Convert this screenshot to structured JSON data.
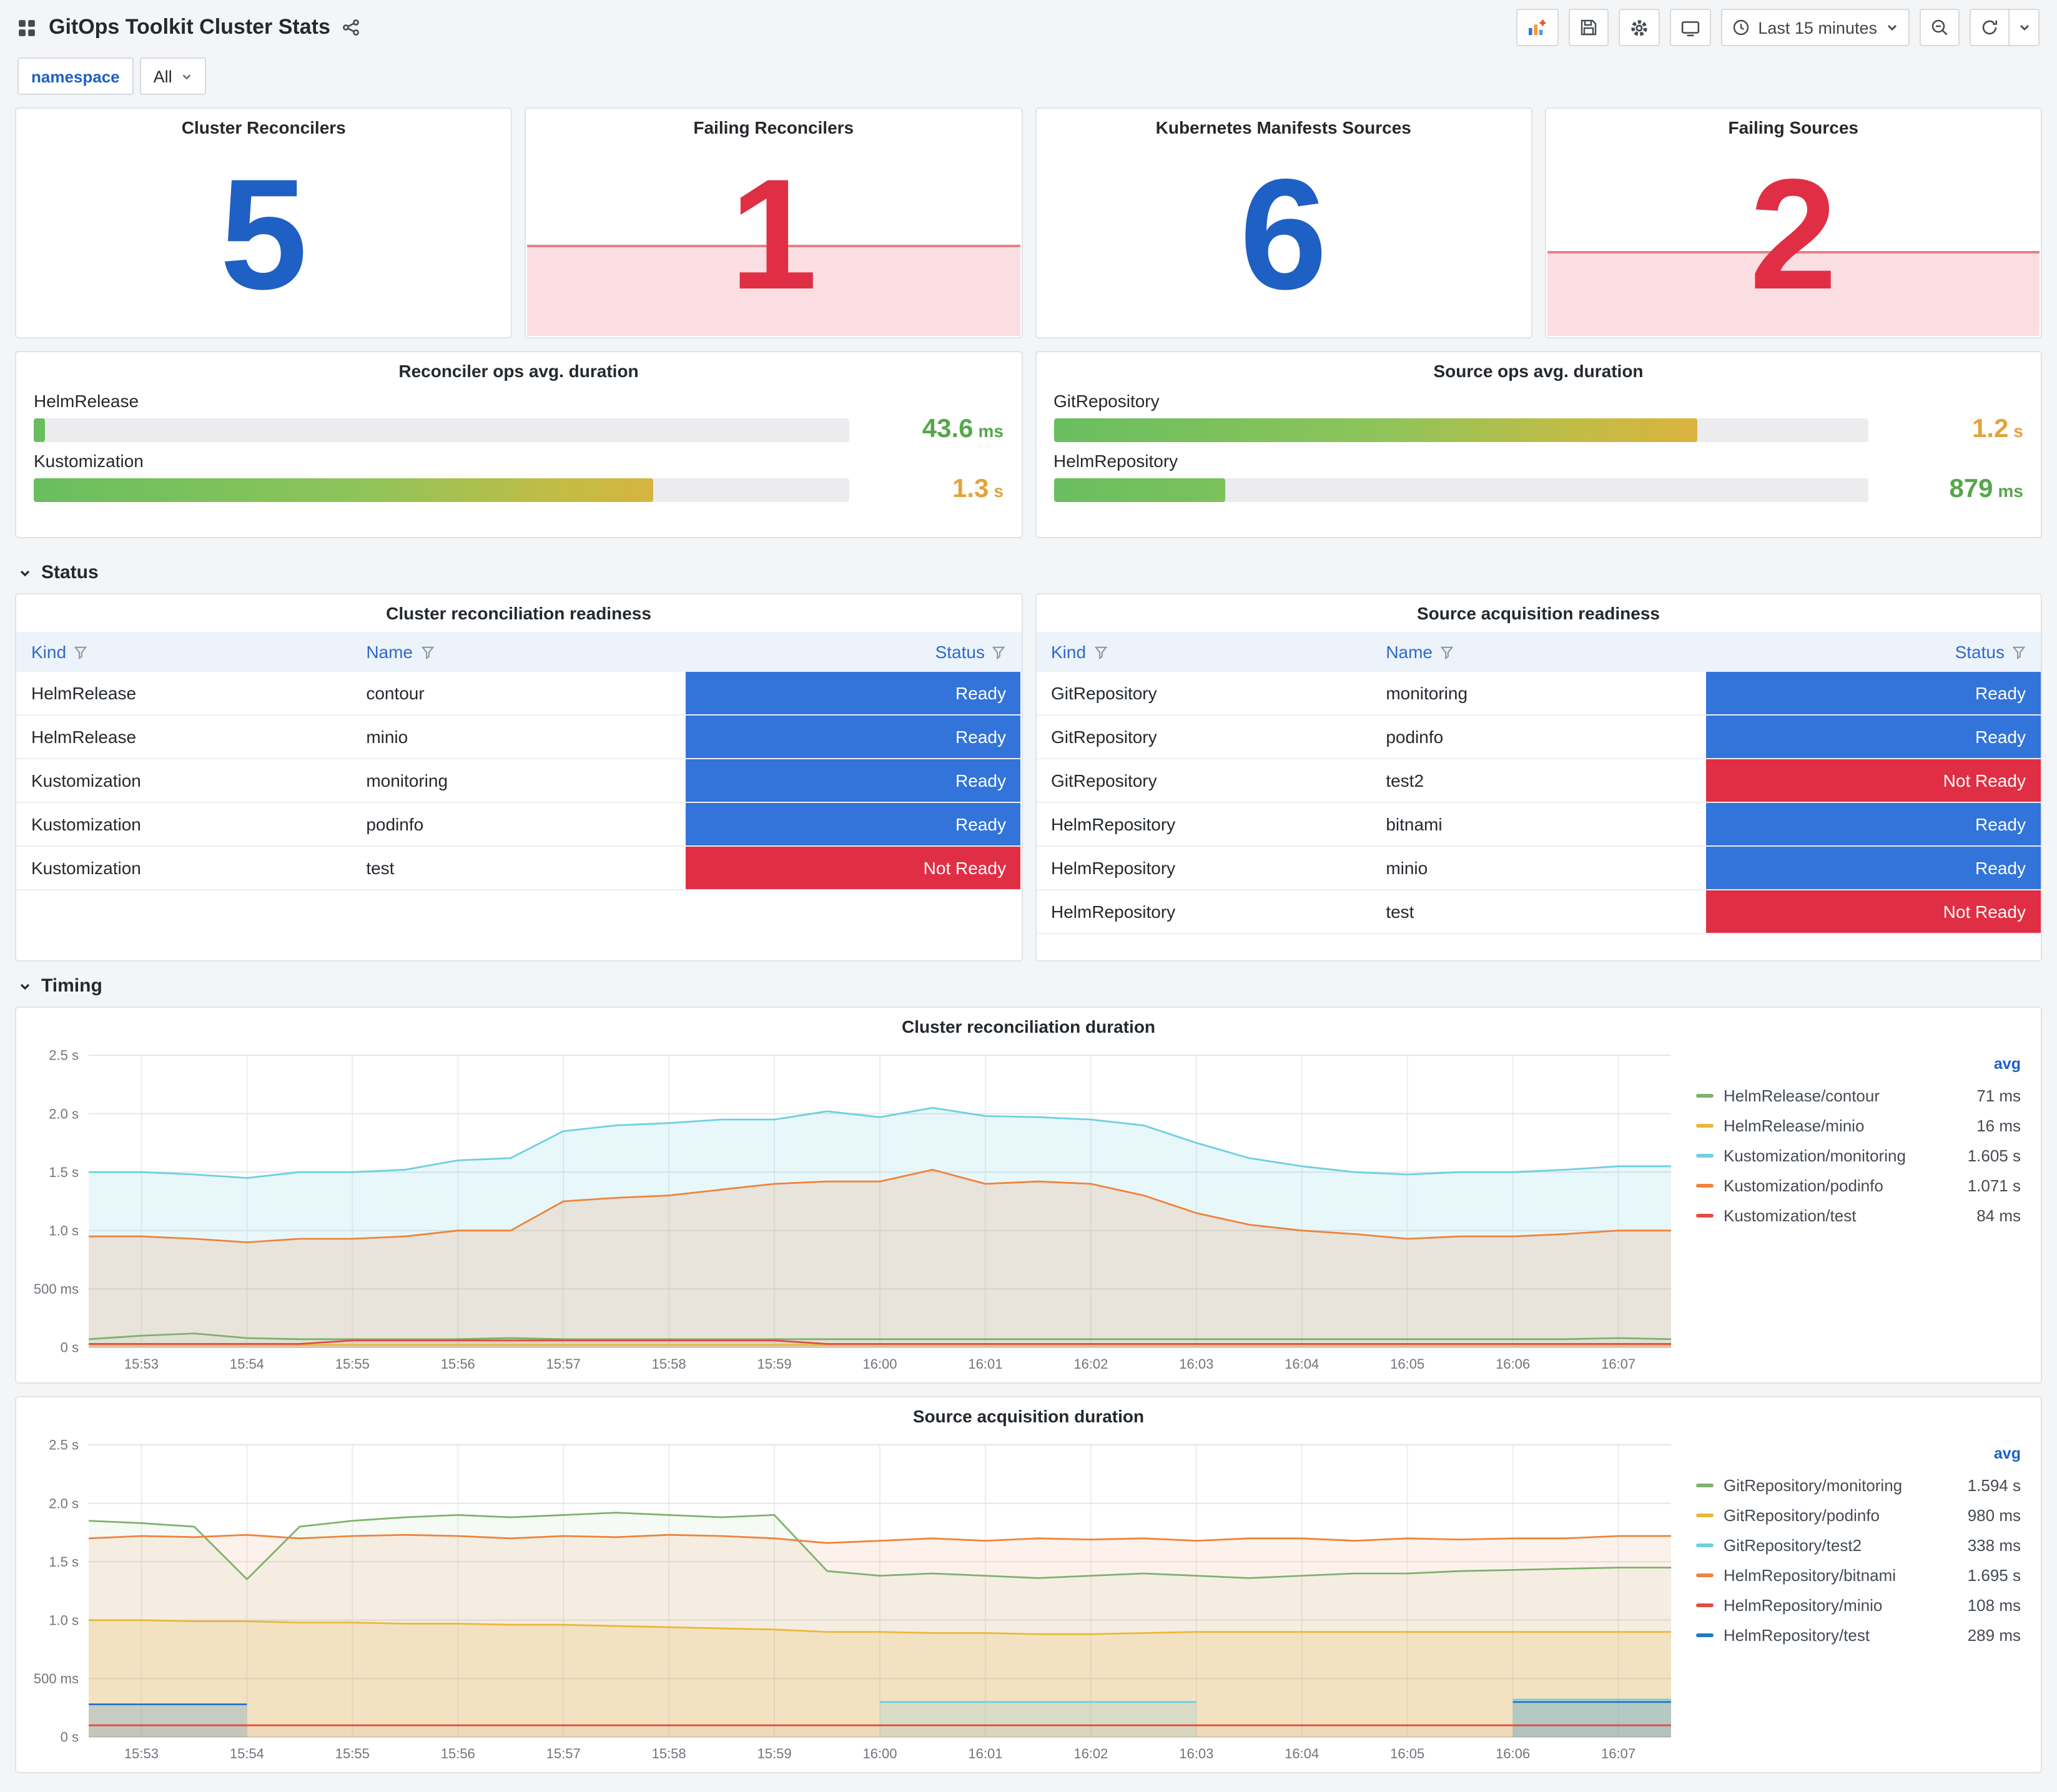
{
  "header": {
    "title": "GitOps Toolkit Cluster Stats",
    "time_range": "Last 15 minutes"
  },
  "filters": {
    "namespace_label": "namespace",
    "namespace_value": "All"
  },
  "sections": {
    "status": "Status",
    "timing": "Timing"
  },
  "icons": {
    "dashboard-grid": "grid-2x2",
    "share": "share-nodes",
    "add-panel": "chart-plus",
    "save": "floppy-disk",
    "settings": "gear",
    "tv": "monitor",
    "clock": "clock",
    "zoom-out": "magnifier-minus",
    "refresh": "sync-arrows",
    "caret": "chevron-down",
    "filter": "funnel",
    "section-chevron": "chevron-down"
  },
  "stats": [
    {
      "title": "Cluster Reconcilers",
      "value": "5",
      "color": "#1F60C4",
      "sparkline": false,
      "spark_height": 0
    },
    {
      "title": "Failing Reconcilers",
      "value": "1",
      "color": "#E02F44",
      "sparkline": true,
      "spark_height": 0.4,
      "spark_fill": "rgba(224,47,68,0.16)",
      "spark_line": "rgba(224,47,68,0.55)"
    },
    {
      "title": "Kubernetes Manifests Sources",
      "value": "6",
      "color": "#1F60C4",
      "sparkline": false,
      "spark_height": 0
    },
    {
      "title": "Failing Sources",
      "value": "2",
      "color": "#E02F44",
      "sparkline": true,
      "spark_height": 0.37,
      "spark_fill": "rgba(224,47,68,0.16)",
      "spark_line": "rgba(224,47,68,0.55)"
    }
  ],
  "gauge_gradient": [
    "#69BE5F",
    "#8EC45A",
    "#C3BC45",
    "#E5AE3B",
    "#EA9A33"
  ],
  "gauges": [
    {
      "title": "Reconciler ops avg. duration",
      "rows": [
        {
          "label": "HelmRelease",
          "percent": 1.4,
          "value": "43.6",
          "unit": "ms",
          "value_color": "#56A64B"
        },
        {
          "label": "Kustomization",
          "percent": 76,
          "value": "1.3",
          "unit": "s",
          "value_color": "#E2A33C"
        }
      ]
    },
    {
      "title": "Source ops avg. duration",
      "rows": [
        {
          "label": "GitRepository",
          "percent": 79,
          "value": "1.2",
          "unit": "s",
          "value_color": "#E2A33C"
        },
        {
          "label": "HelmRepository",
          "percent": 21,
          "value": "879",
          "unit": "ms",
          "value_color": "#56A64B"
        }
      ]
    }
  ],
  "status_colors": {
    "Ready": "#3274D9",
    "Not Ready": "#E02F44"
  },
  "tables": [
    {
      "title": "Cluster reconciliation readiness",
      "columns": [
        "Kind",
        "Name",
        "Status"
      ],
      "rows": [
        [
          "HelmRelease",
          "contour",
          "Ready"
        ],
        [
          "HelmRelease",
          "minio",
          "Ready"
        ],
        [
          "Kustomization",
          "monitoring",
          "Ready"
        ],
        [
          "Kustomization",
          "podinfo",
          "Ready"
        ],
        [
          "Kustomization",
          "test",
          "Not Ready"
        ]
      ]
    },
    {
      "title": "Source acquisition readiness",
      "columns": [
        "Kind",
        "Name",
        "Status"
      ],
      "rows": [
        [
          "GitRepository",
          "monitoring",
          "Ready"
        ],
        [
          "GitRepository",
          "podinfo",
          "Ready"
        ],
        [
          "GitRepository",
          "test2",
          "Not Ready"
        ],
        [
          "HelmRepository",
          "bitnami",
          "Ready"
        ],
        [
          "HelmRepository",
          "minio",
          "Ready"
        ],
        [
          "HelmRepository",
          "test",
          "Not Ready"
        ]
      ]
    }
  ],
  "chart_data": [
    {
      "type": "line",
      "title": "Cluster reconciliation duration",
      "xlabel": "",
      "ylabel": "",
      "ylim": [
        0,
        2.5
      ],
      "y_ticks": [
        {
          "v": 0,
          "label": "0 s"
        },
        {
          "v": 0.5,
          "label": "500 ms"
        },
        {
          "v": 1.0,
          "label": "1.0 s"
        },
        {
          "v": 1.5,
          "label": "1.5 s"
        },
        {
          "v": 2.0,
          "label": "2.0 s"
        },
        {
          "v": 2.5,
          "label": "2.5 s"
        }
      ],
      "x_ticks": [
        "15:53",
        "15:54",
        "15:55",
        "15:56",
        "15:57",
        "15:58",
        "15:59",
        "16:00",
        "16:01",
        "16:02",
        "16:03",
        "16:04",
        "16:05",
        "16:06",
        "16:07"
      ],
      "legend_header": "avg",
      "legend_position": "right",
      "grid": true,
      "series": [
        {
          "name": "HelmRelease/contour",
          "color": "#7EB26D",
          "fill": 0.06,
          "avg": "71 ms",
          "values": [
            0.07,
            0.1,
            0.12,
            0.08,
            0.07,
            0.07,
            0.07,
            0.07,
            0.08,
            0.07,
            0.07,
            0.07,
            0.07,
            0.07,
            0.07,
            0.07,
            0.07,
            0.07,
            0.07,
            0.07,
            0.07,
            0.07,
            0.07,
            0.07,
            0.07,
            0.07,
            0.07,
            0.07,
            0.07,
            0.08,
            0.07
          ]
        },
        {
          "name": "HelmRelease/minio",
          "color": "#EAB839",
          "fill": 0.05,
          "avg": "16 ms",
          "values": [
            0.02,
            0.02,
            0.02,
            0.02,
            0.02,
            0.02,
            0.02,
            0.02,
            0.02,
            0.02,
            0.02,
            0.02,
            0.02,
            0.02,
            0.02,
            0.02,
            0.02,
            0.02,
            0.02,
            0.02,
            0.02,
            0.02,
            0.02,
            0.02,
            0.02,
            0.02,
            0.02,
            0.02,
            0.02,
            0.02,
            0.02
          ]
        },
        {
          "name": "Kustomization/monitoring",
          "color": "#6ED0E0",
          "fill": 0.16,
          "avg": "1.605 s",
          "values": [
            1.5,
            1.5,
            1.48,
            1.45,
            1.5,
            1.5,
            1.52,
            1.6,
            1.62,
            1.85,
            1.9,
            1.92,
            1.95,
            1.95,
            2.02,
            1.97,
            2.05,
            1.98,
            1.97,
            1.95,
            1.9,
            1.75,
            1.62,
            1.55,
            1.5,
            1.48,
            1.5,
            1.5,
            1.52,
            1.55,
            1.55
          ]
        },
        {
          "name": "Kustomization/podinfo",
          "color": "#EF843C",
          "fill": 0.16,
          "avg": "1.071 s",
          "values": [
            0.95,
            0.95,
            0.93,
            0.9,
            0.93,
            0.93,
            0.95,
            1.0,
            1.0,
            1.25,
            1.28,
            1.3,
            1.35,
            1.4,
            1.42,
            1.42,
            1.52,
            1.4,
            1.42,
            1.4,
            1.3,
            1.15,
            1.05,
            1.0,
            0.97,
            0.93,
            0.95,
            0.95,
            0.97,
            1.0,
            1.0
          ]
        },
        {
          "name": "Kustomization/test",
          "color": "#E24D42",
          "fill": 0.1,
          "avg": "84 ms",
          "values": [
            0.03,
            0.03,
            0.03,
            0.03,
            0.03,
            0.06,
            0.06,
            0.06,
            0.06,
            0.06,
            0.06,
            0.06,
            0.06,
            0.06,
            0.03,
            0.03,
            0.03,
            0.03,
            0.03,
            0.03,
            0.03,
            0.03,
            0.03,
            0.03,
            0.03,
            0.03,
            0.03,
            0.03,
            0.03,
            0.03,
            0.03
          ]
        }
      ]
    },
    {
      "type": "line",
      "title": "Source acquisition duration",
      "xlabel": "",
      "ylabel": "",
      "ylim": [
        0,
        2.5
      ],
      "y_ticks": [
        {
          "v": 0,
          "label": "0 s"
        },
        {
          "v": 0.5,
          "label": "500 ms"
        },
        {
          "v": 1.0,
          "label": "1.0 s"
        },
        {
          "v": 1.5,
          "label": "1.5 s"
        },
        {
          "v": 2.0,
          "label": "2.0 s"
        },
        {
          "v": 2.5,
          "label": "2.5 s"
        }
      ],
      "x_ticks": [
        "15:53",
        "15:54",
        "15:55",
        "15:56",
        "15:57",
        "15:58",
        "15:59",
        "16:00",
        "16:01",
        "16:02",
        "16:03",
        "16:04",
        "16:05",
        "16:06",
        "16:07"
      ],
      "legend_header": "avg",
      "legend_position": "right",
      "grid": true,
      "series": [
        {
          "name": "GitRepository/monitoring",
          "color": "#7EB26D",
          "fill": 0.07,
          "avg": "1.594 s",
          "values": [
            1.85,
            1.83,
            1.8,
            1.35,
            1.8,
            1.85,
            1.88,
            1.9,
            1.88,
            1.9,
            1.92,
            1.9,
            1.88,
            1.9,
            1.42,
            1.38,
            1.4,
            1.38,
            1.36,
            1.38,
            1.4,
            1.38,
            1.36,
            1.38,
            1.4,
            1.4,
            1.42,
            1.43,
            1.44,
            1.45,
            1.45
          ]
        },
        {
          "name": "GitRepository/podinfo",
          "color": "#EAB839",
          "fill": 0.18,
          "avg": "980 ms",
          "values": [
            1.0,
            1.0,
            0.99,
            0.99,
            0.98,
            0.98,
            0.97,
            0.97,
            0.96,
            0.96,
            0.95,
            0.94,
            0.93,
            0.92,
            0.9,
            0.9,
            0.89,
            0.89,
            0.88,
            0.88,
            0.89,
            0.9,
            0.9,
            0.9,
            0.9,
            0.9,
            0.9,
            0.9,
            0.9,
            0.9,
            0.9
          ]
        },
        {
          "name": "GitRepository/test2",
          "color": "#6ED0E0",
          "fill": 0.2,
          "avg": "338 ms",
          "values": [
            null,
            null,
            null,
            null,
            null,
            null,
            null,
            null,
            null,
            null,
            null,
            null,
            null,
            null,
            null,
            0.3,
            0.3,
            0.3,
            0.3,
            0.3,
            0.3,
            0.3,
            null,
            null,
            null,
            null,
            null,
            0.32,
            0.32,
            0.32,
            0.32
          ]
        },
        {
          "name": "HelmRepository/bitnami",
          "color": "#EF843C",
          "fill": 0.1,
          "avg": "1.695 s",
          "values": [
            1.7,
            1.72,
            1.71,
            1.73,
            1.7,
            1.72,
            1.73,
            1.72,
            1.7,
            1.72,
            1.71,
            1.73,
            1.72,
            1.7,
            1.66,
            1.68,
            1.7,
            1.68,
            1.7,
            1.69,
            1.7,
            1.68,
            1.7,
            1.7,
            1.68,
            1.7,
            1.69,
            1.7,
            1.7,
            1.72,
            1.72
          ]
        },
        {
          "name": "HelmRepository/minio",
          "color": "#E24D42",
          "fill": 0.06,
          "avg": "108 ms",
          "values": [
            0.1,
            0.1,
            0.1,
            0.1,
            0.1,
            0.1,
            0.1,
            0.1,
            0.1,
            0.1,
            0.1,
            0.1,
            0.1,
            0.1,
            0.1,
            0.1,
            0.1,
            0.1,
            0.1,
            0.1,
            0.1,
            0.1,
            0.1,
            0.1,
            0.1,
            0.1,
            0.1,
            0.1,
            0.1,
            0.1,
            0.1
          ]
        },
        {
          "name": "HelmRepository/test",
          "color": "#1F78C1",
          "fill": 0.2,
          "avg": "289 ms",
          "values": [
            0.28,
            0.28,
            0.28,
            0.28,
            null,
            null,
            null,
            null,
            null,
            null,
            null,
            null,
            null,
            null,
            null,
            null,
            null,
            null,
            null,
            null,
            null,
            null,
            null,
            null,
            null,
            null,
            null,
            0.3,
            0.3,
            0.3,
            0.3
          ]
        }
      ]
    }
  ]
}
